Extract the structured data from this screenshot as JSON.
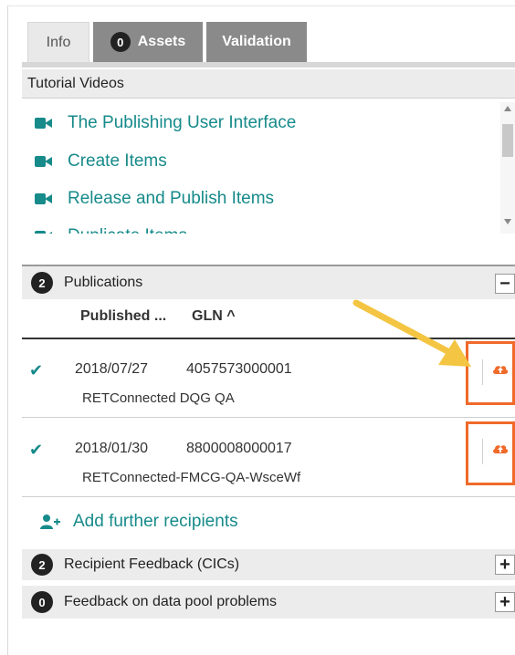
{
  "tabs": {
    "info": "Info",
    "assets": {
      "count": "0",
      "label": "Assets"
    },
    "validation": "Validation"
  },
  "tutorial": {
    "header": "Tutorial Videos",
    "items": [
      "The Publishing User Interface",
      "Create Items",
      "Release and Publish Items",
      "Duplicate Items"
    ]
  },
  "publications": {
    "count": "2",
    "title": "Publications",
    "toggle": "−",
    "columns": {
      "published": "Published ...",
      "gln": "GLN ^"
    },
    "rows": [
      {
        "date": "2018/07/27",
        "gln": "4057573000001",
        "name": "RETConnected DQG QA"
      },
      {
        "date": "2018/01/30",
        "gln": "8800008000017",
        "name": "RETConnected-FMCG-QA-WsceWf"
      }
    ]
  },
  "add_recipients": "Add further recipients",
  "recipient_feedback": {
    "count": "2",
    "title": "Recipient Feedback (CICs)",
    "toggle": "+"
  },
  "datapool_feedback": {
    "count": "0",
    "title": "Feedback on data pool problems",
    "toggle": "+"
  },
  "colors": {
    "teal": "#178a8a",
    "orange": "#f06a2a",
    "arrow": "#f4c542"
  },
  "icons": [
    "video-camera-icon",
    "check-icon",
    "cloud-upload-icon",
    "add-user-icon",
    "minus-icon",
    "plus-icon"
  ]
}
